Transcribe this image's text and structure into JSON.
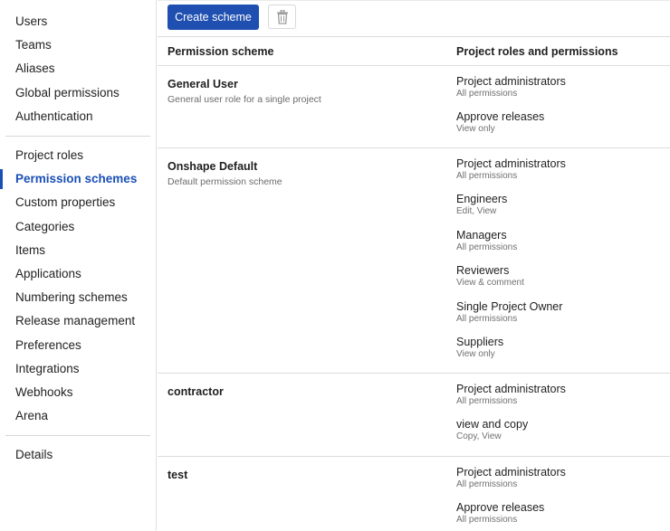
{
  "sidebar": {
    "groups": [
      [
        "Users",
        "Teams",
        "Aliases",
        "Global permissions",
        "Authentication"
      ],
      [
        "Project roles",
        "Permission schemes",
        "Custom properties",
        "Categories",
        "Items",
        "Applications",
        "Numbering schemes",
        "Release management",
        "Preferences",
        "Integrations",
        "Webhooks",
        "Arena"
      ],
      [
        "Details"
      ]
    ],
    "active": "Permission schemes"
  },
  "toolbar": {
    "create_label": "Create scheme",
    "delete_icon": "trash-icon"
  },
  "table": {
    "headers": {
      "scheme": "Permission scheme",
      "roles": "Project roles and permissions"
    },
    "rows": [
      {
        "name": "General User",
        "description": "General user role for a single project",
        "roles": [
          {
            "role": "Project administrators",
            "permissions": "All permissions"
          },
          {
            "role": "Approve releases",
            "permissions": "View only"
          }
        ]
      },
      {
        "name": "Onshape Default",
        "description": "Default permission scheme",
        "roles": [
          {
            "role": "Project administrators",
            "permissions": "All permissions"
          },
          {
            "role": "Engineers",
            "permissions": "Edit, View"
          },
          {
            "role": "Managers",
            "permissions": "All permissions"
          },
          {
            "role": "Reviewers",
            "permissions": "View & comment"
          },
          {
            "role": "Single Project Owner",
            "permissions": "All permissions"
          },
          {
            "role": "Suppliers",
            "permissions": "View only"
          }
        ]
      },
      {
        "name": "contractor",
        "description": "",
        "roles": [
          {
            "role": "Project administrators",
            "permissions": "All permissions"
          },
          {
            "role": "view and copy",
            "permissions": "Copy, View"
          }
        ]
      },
      {
        "name": "test",
        "description": "",
        "roles": [
          {
            "role": "Project administrators",
            "permissions": "All permissions"
          },
          {
            "role": "Approve releases",
            "permissions": "All permissions"
          }
        ]
      }
    ]
  },
  "colors": {
    "accent": "#1a4fb6",
    "button": "#1f4fb0"
  }
}
